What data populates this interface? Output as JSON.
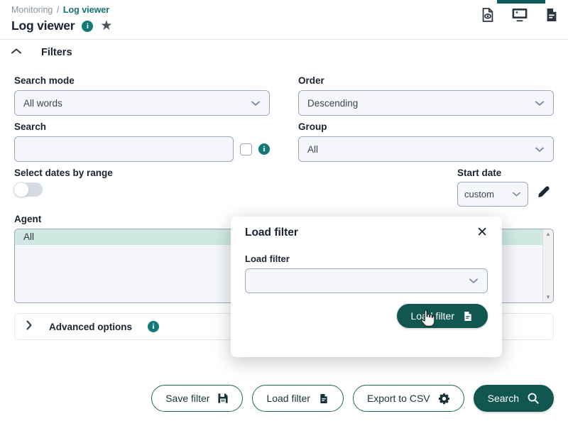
{
  "header": {
    "breadcrumb": {
      "parent": "Monitoring",
      "separator": "/",
      "current": "Log viewer"
    },
    "title": "Log viewer",
    "info_icon_label": "i",
    "star_icon_label": "★",
    "actions": [
      {
        "name": "document-eye-icon",
        "label": "View report"
      },
      {
        "name": "monitor-icon",
        "label": "Display"
      },
      {
        "name": "document-lines-icon",
        "label": "Report"
      }
    ]
  },
  "filters": {
    "collapse_label": "Filters",
    "search_mode": {
      "label": "Search mode",
      "value": "All words"
    },
    "order": {
      "label": "Order",
      "value": "Descending"
    },
    "search": {
      "label": "Search",
      "value": "",
      "placeholder": ""
    },
    "group": {
      "label": "Group",
      "value": "All"
    },
    "select_dates_by_range": {
      "label": "Select dates by range",
      "state": "off"
    },
    "start_date": {
      "label": "Start date",
      "value": "custom"
    },
    "agent": {
      "label": "Agent",
      "options": [
        "All"
      ],
      "selected": "All"
    },
    "advanced_options": {
      "label": "Advanced options"
    }
  },
  "footer": {
    "save_filter": "Save filter",
    "load_filter": "Load filter",
    "export_csv": "Export to CSV",
    "search": "Search"
  },
  "modal": {
    "title": "Load filter",
    "close_label": "✕",
    "field_label": "Load filter",
    "select_value": "",
    "submit_label": "Load filter"
  },
  "colors": {
    "accent_teal": "#11564f",
    "info_teal": "#137a78",
    "breadcrumb_current": "#12726f",
    "selected_row": "#cfe9e2",
    "field_bg": "#f4f6fa",
    "field_border": "#9aa8bd"
  }
}
